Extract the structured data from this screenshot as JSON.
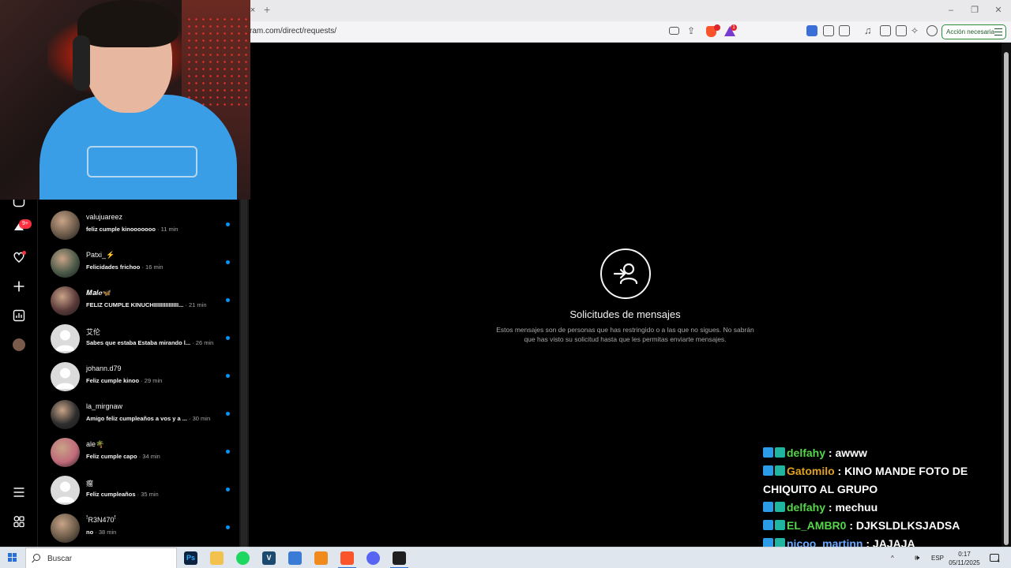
{
  "browser": {
    "url": "ram.com/direct/requests/",
    "action_button": "Acción necesaria",
    "new_tab": "+",
    "close_tab": "×",
    "extension_badge": "1"
  },
  "instagram": {
    "nav_badge": "9+",
    "requests": [
      {
        "name": "valujuareez",
        "message": "feliz cumple kinooooooo",
        "time": "· 11 min",
        "avatar": "#6b5a4a"
      },
      {
        "name": "Patxi_⚡",
        "message": "Felicidades frichoo",
        "time": "· 16 min",
        "avatar": "#4a5a48"
      },
      {
        "name": "𝑴𝒂𝒍𝒆🦋",
        "message": "FELIZ CUMPLE KINUCHIIIIIIIIIIIIIII...",
        "time": "· 21 min",
        "avatar": "#5a3a3a"
      },
      {
        "name": "艾伦",
        "message": "Sabes que estaba Estaba mirando l...",
        "time": "· 26 min",
        "avatar": "default"
      },
      {
        "name": "johann.d79",
        "message": "Feliz cumple kinoo",
        "time": "· 29 min",
        "avatar": "default"
      },
      {
        "name": "la_mirgnaw",
        "message": "Amigo feliz cumpleaños a vos y a ...",
        "time": "· 30 min",
        "avatar": "#2d2d2d"
      },
      {
        "name": "ale🌴",
        "message": "Feliz cumple capo",
        "time": "· 34 min",
        "avatar": "#c06a7a"
      },
      {
        "name": "瘤",
        "message": "Feliz cumpleaños",
        "time": "· 35 min",
        "avatar": "default"
      },
      {
        "name": "ꜝR3N470ꜝ",
        "message": "no",
        "time": "· 38 min",
        "avatar": "#6a5a48"
      }
    ],
    "main": {
      "title": "Solicitudes de mensajes",
      "description": "Estos mensajes son de personas que has restringido o a las que no sigues. No sabrán que has visto su solicitud hasta que les permitas enviarte mensajes."
    }
  },
  "chat": [
    {
      "user": "delfahy",
      "message": " : awww",
      "color": "#56d64a"
    },
    {
      "user": "Gatomilo",
      "message": " : KINO MANDE FOTO DE CHIQUITO AL GRUPO",
      "color": "#e0a21e"
    },
    {
      "user": "delfahy",
      "message": " : mechuu",
      "color": "#56d64a"
    },
    {
      "user": "EL_AMBR0",
      "message": " : DJKSLDLKSJADSA",
      "color": "#56d64a"
    },
    {
      "user": "nicoo_martinn",
      "message": " : JAJAJA",
      "color": "#6aa8ff"
    }
  ],
  "taskbar": {
    "search_label": "Buscar",
    "language": "ESP",
    "time": "0:17",
    "date": "05/11/2025",
    "notification_count": "4",
    "apps": [
      {
        "name": "photoshop",
        "label": "Ps",
        "bg": "#0b2340",
        "fg": "#31a8ff"
      },
      {
        "name": "file-explorer",
        "label": "",
        "bg": "#f2c14e",
        "fg": "#000"
      },
      {
        "name": "spotify",
        "label": "",
        "bg": "#1ed760",
        "fg": "#000"
      },
      {
        "name": "vegas",
        "label": "V",
        "bg": "#1c4a6e",
        "fg": "#fff"
      },
      {
        "name": "installer",
        "label": "",
        "bg": "#3a7bd5",
        "fg": "#fff"
      },
      {
        "name": "fl-studio",
        "label": "",
        "bg": "#f08a1c",
        "fg": "#fff"
      },
      {
        "name": "brave",
        "label": "",
        "bg": "#fb542b",
        "fg": "#fff"
      },
      {
        "name": "discord",
        "label": "",
        "bg": "#5865f2",
        "fg": "#fff"
      },
      {
        "name": "obs",
        "label": "",
        "bg": "#1f1f1f",
        "fg": "#fff"
      }
    ]
  }
}
